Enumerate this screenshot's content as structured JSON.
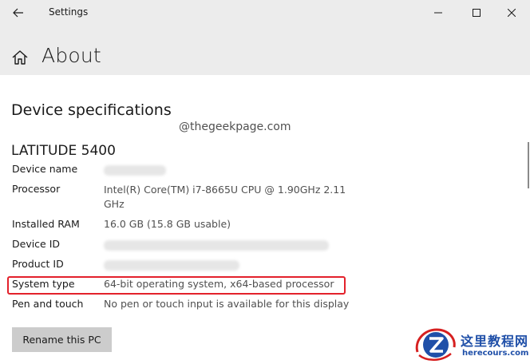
{
  "window": {
    "title": "Settings"
  },
  "header": {
    "page_title": "About"
  },
  "section": {
    "title": "Device specifications"
  },
  "watermark": "@thegeekpage.com",
  "device_model": "LATITUDE 5400",
  "specs": [
    {
      "label": "Device name",
      "value": ""
    },
    {
      "label": "Processor",
      "value_line1": "Intel(R) Core(TM) i7-8665U CPU @ 1.90GHz   2.11",
      "value_line2": "GHz"
    },
    {
      "label": "Installed RAM",
      "value": "16.0 GB (15.8 GB usable)"
    },
    {
      "label": "Device ID",
      "value": ""
    },
    {
      "label": "Product ID",
      "value": ""
    },
    {
      "label": "System type",
      "value": "64-bit operating system, x64-based processor"
    },
    {
      "label": "Pen and touch",
      "value": "No pen or touch input is available for this display"
    }
  ],
  "rename_button": "Rename this PC",
  "logo": {
    "cn": "这里教程网",
    "en": "herecours.com"
  },
  "colors": {
    "header_bg": "#ececec",
    "highlight": "#e3212b",
    "button_bg": "#cccccc",
    "logo_blue": "#1f4fa8"
  },
  "icons": [
    "back-arrow-icon",
    "minimize-icon",
    "maximize-icon",
    "close-icon",
    "home-icon"
  ]
}
